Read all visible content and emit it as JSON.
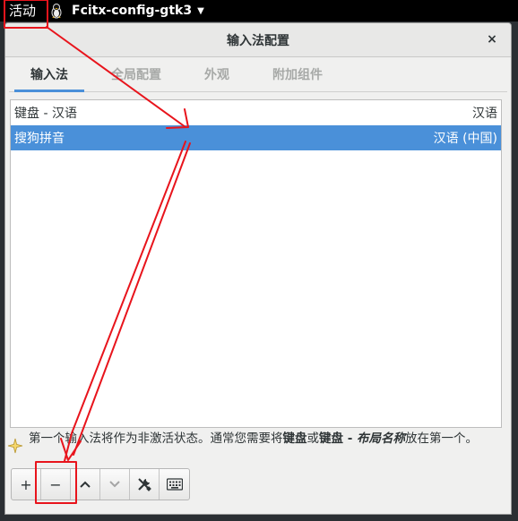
{
  "topbar": {
    "activities_label": "活动",
    "app_name": "Fcitx-config-gtk3"
  },
  "window": {
    "title": "输入法配置",
    "close_glyph": "×"
  },
  "tabs": [
    {
      "label": "输入法",
      "active": true
    },
    {
      "label": "全局配置",
      "active": false
    },
    {
      "label": "外观",
      "active": false
    },
    {
      "label": "附加组件",
      "active": false
    }
  ],
  "list": {
    "header": {
      "name": "键盘 - 汉语",
      "language": "汉语"
    },
    "rows": [
      {
        "name": "搜狗拼音",
        "language": "汉语 (中国)",
        "selected": true
      }
    ]
  },
  "hint": {
    "part1": "第一个输入法将作为非激活状态。通常您需要将",
    "keyboard": "键盘",
    "or": "或",
    "keyboard2": "键盘 - ",
    "layout_name": "布局名称",
    "part2": "放在第一个。"
  },
  "toolbar": {
    "add": "+",
    "remove": "−"
  },
  "colors": {
    "accent": "#4a90d9",
    "annotation": "#e8141c"
  }
}
